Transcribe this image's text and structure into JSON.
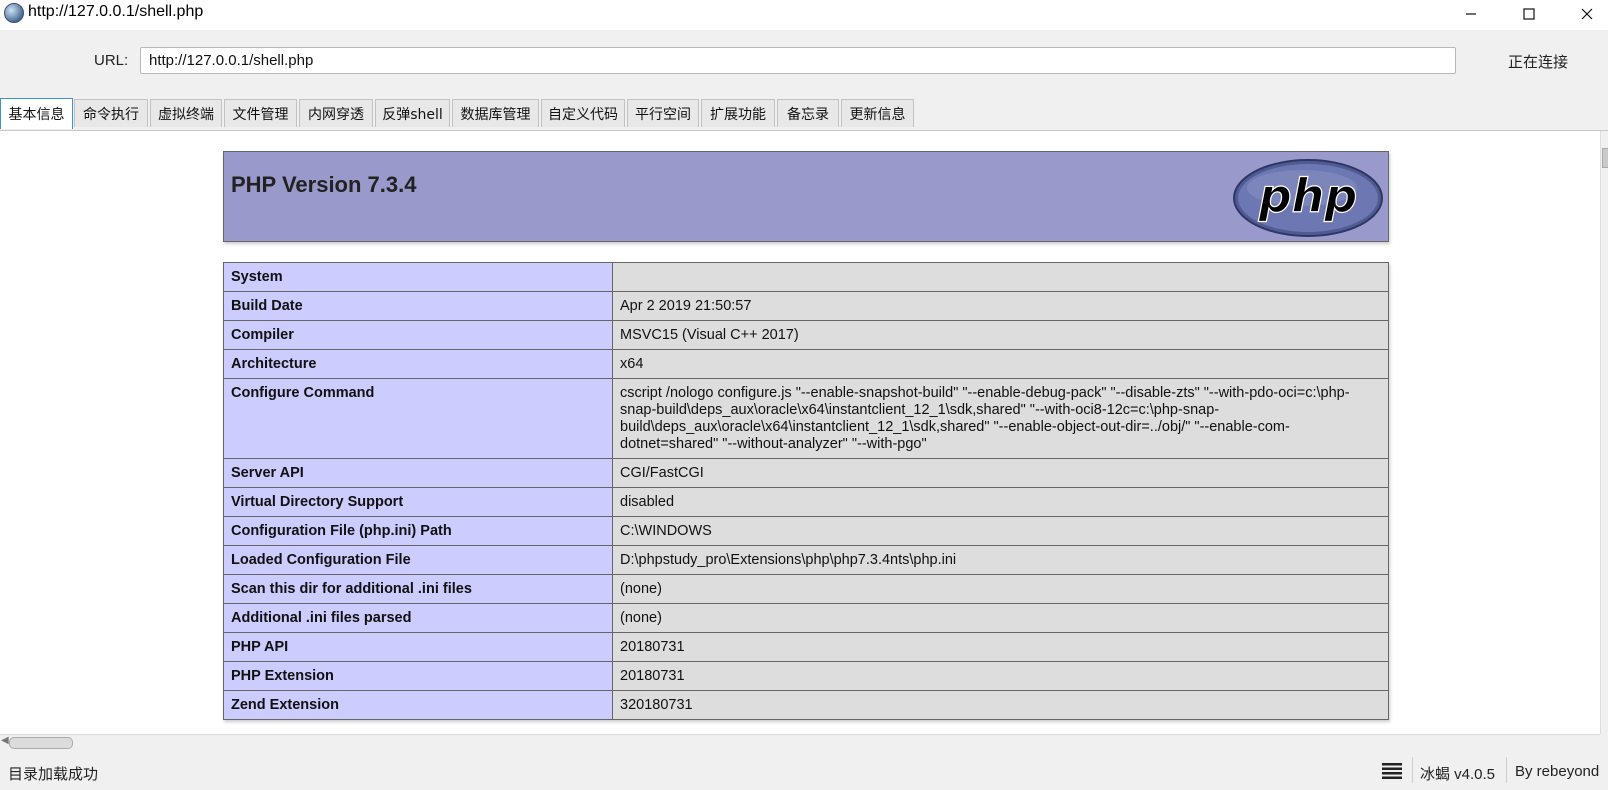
{
  "window": {
    "title": "http://127.0.0.1/shell.php"
  },
  "urlbar": {
    "label": "URL:",
    "value": "http://127.0.0.1/shell.php",
    "status": "正在连接"
  },
  "tabs": [
    {
      "label": "基本信息",
      "active": true
    },
    {
      "label": "命令执行"
    },
    {
      "label": "虚拟终端"
    },
    {
      "label": "文件管理"
    },
    {
      "label": "内网穿透"
    },
    {
      "label": "反弹shell"
    },
    {
      "label": "数据库管理"
    },
    {
      "label": "自定义代码"
    },
    {
      "label": "平行空间"
    },
    {
      "label": "扩展功能"
    },
    {
      "label": "备忘录"
    },
    {
      "label": "更新信息"
    }
  ],
  "phpinfo": {
    "title": "PHP Version 7.3.4",
    "logo_text": "php",
    "rows": [
      {
        "key": "System",
        "value": ""
      },
      {
        "key": "Build Date",
        "value": "Apr 2 2019 21:50:57"
      },
      {
        "key": "Compiler",
        "value": "MSVC15 (Visual C++ 2017)"
      },
      {
        "key": "Architecture",
        "value": "x64"
      },
      {
        "key": "Configure Command",
        "value": "cscript /nologo configure.js \"--enable-snapshot-build\" \"--enable-debug-pack\" \"--disable-zts\" \"--with-pdo-oci=c:\\php-snap-build\\deps_aux\\oracle\\x64\\instantclient_12_1\\sdk,shared\" \"--with-oci8-12c=c:\\php-snap-build\\deps_aux\\oracle\\x64\\instantclient_12_1\\sdk,shared\" \"--enable-object-out-dir=../obj/\" \"--enable-com-dotnet=shared\" \"--without-analyzer\" \"--with-pgo\""
      },
      {
        "key": "Server API",
        "value": "CGI/FastCGI"
      },
      {
        "key": "Virtual Directory Support",
        "value": "disabled"
      },
      {
        "key": "Configuration File (php.ini) Path",
        "value": "C:\\WINDOWS"
      },
      {
        "key": "Loaded Configuration File",
        "value": "D:\\phpstudy_pro\\Extensions\\php\\php7.3.4nts\\php.ini"
      },
      {
        "key": "Scan this dir for additional .ini files",
        "value": "(none)"
      },
      {
        "key": "Additional .ini files parsed",
        "value": "(none)"
      },
      {
        "key": "PHP API",
        "value": "20180731"
      },
      {
        "key": "PHP Extension",
        "value": "20180731"
      },
      {
        "key": "Zend Extension",
        "value": "320180731"
      }
    ]
  },
  "statusbar": {
    "message": "目录加载成功",
    "version": "冰蝎 v4.0.5",
    "author": "By rebeyond"
  },
  "colors": {
    "php_header_bg": "#9999cc",
    "key_cell_bg": "#ccccff",
    "value_cell_bg": "#dddddd",
    "active_tab_border": "#3d8fd6"
  },
  "icons": {
    "app": "behinder-app-icon",
    "minimize": "minimize-icon",
    "maximize": "maximize-icon",
    "close": "close-icon",
    "statusbar_menu": "menu-lines-icon"
  }
}
